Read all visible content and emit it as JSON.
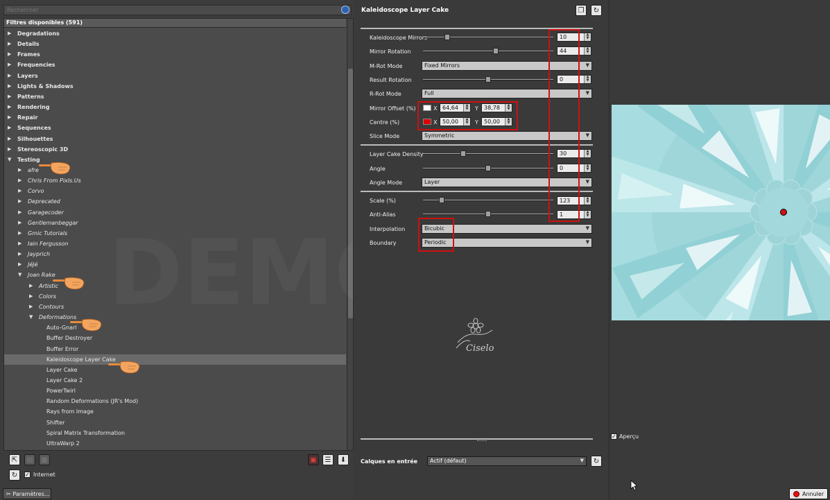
{
  "search": {
    "placeholder": "Rechercher"
  },
  "tree": {
    "header": "Filtres disponibles (591)",
    "rows": [
      {
        "label": "Degradations",
        "level": 0,
        "arrow": "right"
      },
      {
        "label": "Details",
        "level": 0,
        "arrow": "right"
      },
      {
        "label": "Frames",
        "level": 0,
        "arrow": "right"
      },
      {
        "label": "Frequencies",
        "level": 0,
        "arrow": "right"
      },
      {
        "label": "Layers",
        "level": 0,
        "arrow": "right"
      },
      {
        "label": "Lights & Shadows",
        "level": 0,
        "arrow": "right"
      },
      {
        "label": "Patterns",
        "level": 0,
        "arrow": "right"
      },
      {
        "label": "Rendering",
        "level": 0,
        "arrow": "right"
      },
      {
        "label": "Repair",
        "level": 0,
        "arrow": "right"
      },
      {
        "label": "Sequences",
        "level": 0,
        "arrow": "right"
      },
      {
        "label": "Silhouettes",
        "level": 0,
        "arrow": "right"
      },
      {
        "label": "Stereoscopic 3D",
        "level": 0,
        "arrow": "right"
      },
      {
        "label": "Testing",
        "level": 0,
        "arrow": "down"
      },
      {
        "label": "afre",
        "level": 1,
        "arrow": "right"
      },
      {
        "label": "Chris From Pixls.Us",
        "level": 1,
        "arrow": "right"
      },
      {
        "label": "Corvo",
        "level": 1,
        "arrow": "right"
      },
      {
        "label": "Deprecated",
        "level": 1,
        "arrow": "right"
      },
      {
        "label": "Garagecoder",
        "level": 1,
        "arrow": "right"
      },
      {
        "label": "Gentlemanbeggar",
        "level": 1,
        "arrow": "right"
      },
      {
        "label": "Gmic Tutorials",
        "level": 1,
        "arrow": "right"
      },
      {
        "label": "Iain Fergusson",
        "level": 1,
        "arrow": "right"
      },
      {
        "label": "Jayprich",
        "level": 1,
        "arrow": "right"
      },
      {
        "label": "JéJé",
        "level": 1,
        "arrow": "right"
      },
      {
        "label": "Joan Rake",
        "level": 1,
        "arrow": "down"
      },
      {
        "label": "Artistic",
        "level": 2,
        "arrow": "right"
      },
      {
        "label": "Colors",
        "level": 2,
        "arrow": "right"
      },
      {
        "label": "Contours",
        "level": 2,
        "arrow": "right"
      },
      {
        "label": "Deformations",
        "level": 2,
        "arrow": "down"
      },
      {
        "label": "Auto-Gnarl",
        "level": 3,
        "arrow": ""
      },
      {
        "label": "Buffer Destroyer",
        "level": 3,
        "arrow": ""
      },
      {
        "label": "Buffer Error",
        "level": 3,
        "arrow": ""
      },
      {
        "label": "Kaleidoscope Layer Cake",
        "level": 3,
        "arrow": "",
        "selected": true
      },
      {
        "label": "Layer Cake",
        "level": 3,
        "arrow": ""
      },
      {
        "label": "Layer Cake 2",
        "level": 3,
        "arrow": ""
      },
      {
        "label": "PowerTwirl",
        "level": 3,
        "arrow": ""
      },
      {
        "label": "Random Deformations (JR's Mod)",
        "level": 3,
        "arrow": ""
      },
      {
        "label": "Rays from Image",
        "level": 3,
        "arrow": ""
      },
      {
        "label": "Shifter",
        "level": 3,
        "arrow": ""
      },
      {
        "label": "Spiral Matrix Transformation",
        "level": 3,
        "arrow": ""
      },
      {
        "label": "UltraWarp 2",
        "level": 3,
        "arrow": ""
      }
    ]
  },
  "watermark": "DEMO VER",
  "bottom_left": {
    "internet_label": "Internet",
    "internet_checked": true,
    "params_label": "Paramètres..."
  },
  "filter": {
    "title": "Kaleidoscope Layer Cake",
    "params": {
      "kaleidoscope_mirrors": {
        "label": "Kaleidoscope Mirrors",
        "value": "10",
        "fraction": 0.17
      },
      "mirror_rotation": {
        "label": "Mirror Rotation",
        "value": "44",
        "fraction": 0.56
      },
      "m_rot_mode": {
        "label": "M-Rot Mode",
        "value": "Fixed Mirrors"
      },
      "result_rotation": {
        "label": "Result Rotation",
        "value": "0",
        "fraction": 0.5
      },
      "r_rot_mode": {
        "label": "R-Rot Mode",
        "value": "Full"
      },
      "mirror_offset": {
        "label": "Mirror Offset (%)",
        "x": "64,64",
        "y": "38,78",
        "swatch": "#ffffff"
      },
      "centre": {
        "label": "Centre (%)",
        "x": "50,00",
        "y": "50,00",
        "swatch": "#e00000"
      },
      "slice_mode": {
        "label": "Slice Mode",
        "value": "Symmetric"
      },
      "layer_cake_density": {
        "label": "Layer Cake Density",
        "value": "30",
        "fraction": 0.3
      },
      "angle": {
        "label": "Angle",
        "value": "0",
        "fraction": 0.5
      },
      "angle_mode": {
        "label": "Angle Mode",
        "value": "Layer"
      },
      "scale": {
        "label": "Scale (%)",
        "value": "123",
        "fraction": 0.13
      },
      "anti_alias": {
        "label": "Anti-Alias",
        "value": "1",
        "fraction": 0.5
      },
      "interpolation": {
        "label": "Interpolation",
        "value": "Bicubic"
      },
      "boundary": {
        "label": "Boundary",
        "value": "Periodic"
      }
    },
    "input_layers_label": "Calques en entrée",
    "input_layers_value": "Actif (défaut)",
    "logo_text": "Ciselo"
  },
  "preview": {
    "apercu_label": "Aperçu",
    "apercu_checked": true,
    "cancel_label": "Annuler"
  },
  "colors": {
    "accent_red": "#d01010",
    "preview_teal": "#a7dde0"
  }
}
